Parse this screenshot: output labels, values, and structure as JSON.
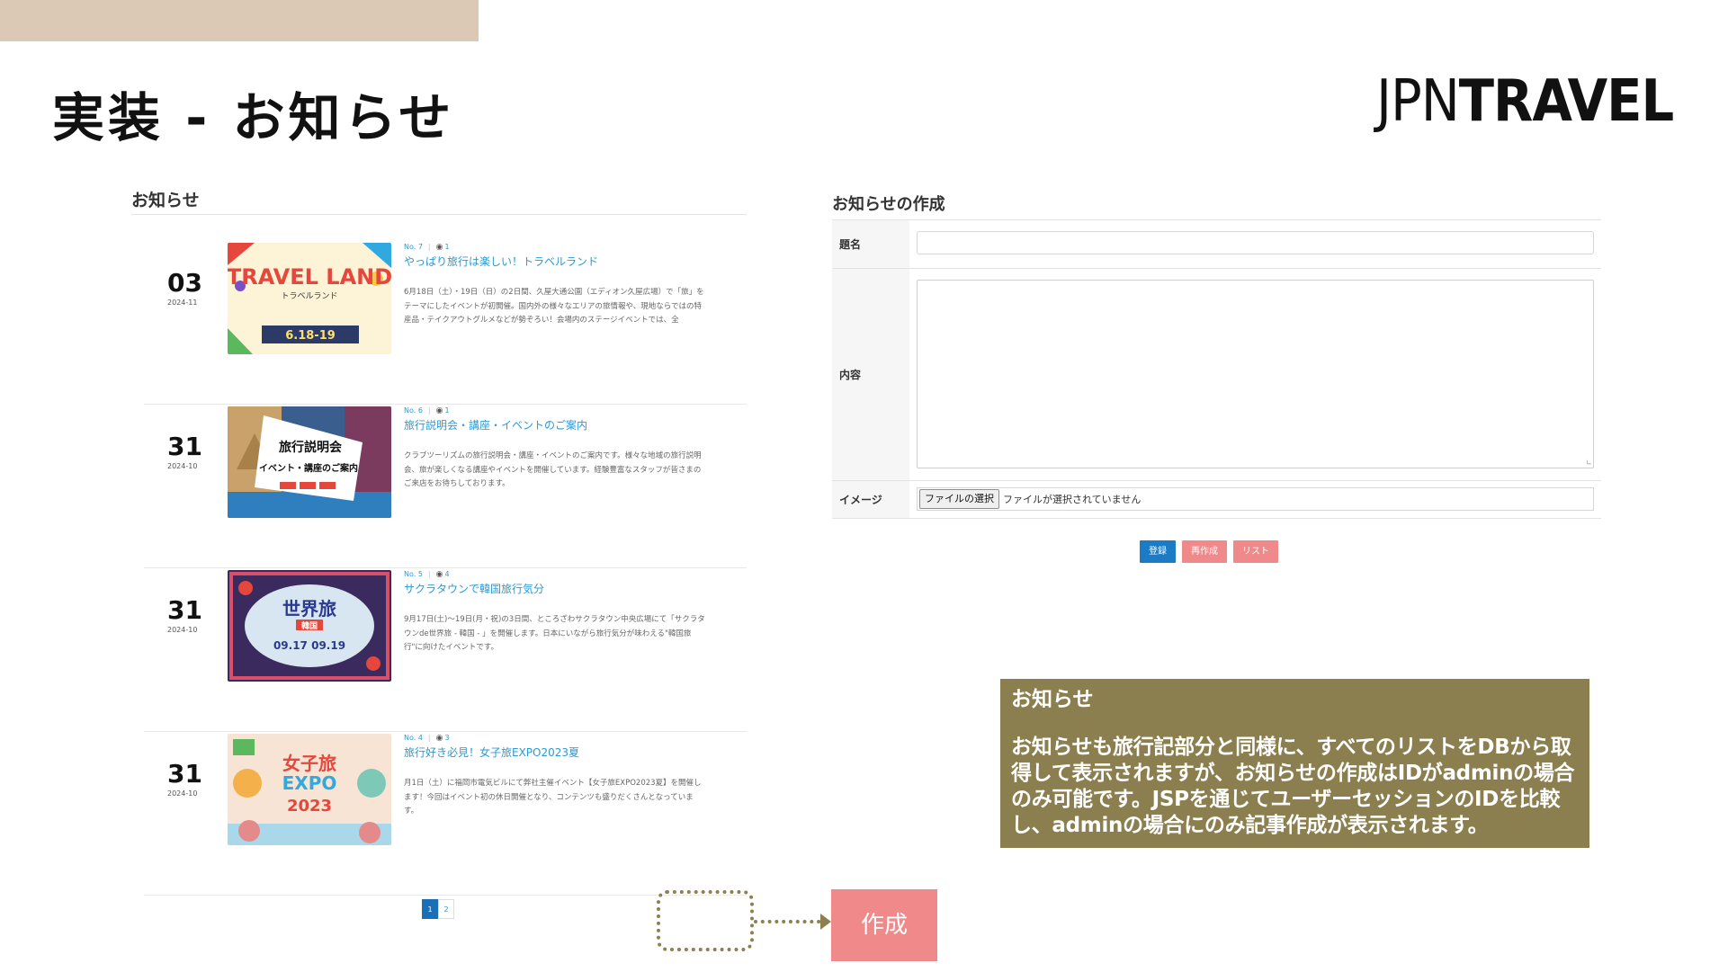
{
  "slide": {
    "title": "実装 - お知らせ",
    "logo_thin": "JPN",
    "logo_bold": "TRAVEL"
  },
  "list": {
    "heading": "お知らせ",
    "items": [
      {
        "day": "03",
        "ym": "2024-11",
        "no": "No. 7",
        "views": "1",
        "title": "やっぱり旅行は楽しい！トラベルランド",
        "desc": "6月18日（土）・19日（日）の2日間、久屋大通公園（エディオン久屋広場）で「旅」をテーマにしたイベントが初開催。国内外の様々なエリアの旅情報や、現地ならではの特産品・テイクアウトグルメなどが勢ぞろい！会場内のステージイベントでは、全",
        "thumb_text": "TRAVEL LAND",
        "thumb_sub": "トラベルランド",
        "thumb_date": "6.18-19"
      },
      {
        "day": "31",
        "ym": "2024-10",
        "no": "No. 6",
        "views": "1",
        "title": "旅行説明会・講座・イベントのご案内",
        "desc": "クラブツーリズムの旅行説明会・講座・イベントのご案内です。様々な地域の旅行説明会、旅が楽しくなる講座やイベントを開催しています。経験豊富なスタッフが皆さまのご来店をお待ちしております。",
        "thumb_text": "旅行説明会",
        "thumb_sub": "イベント・講座のご案内"
      },
      {
        "day": "31",
        "ym": "2024-10",
        "no": "No. 5",
        "views": "4",
        "title": "サクラタウンで韓国旅行気分",
        "desc": "9月17日(土)〜19日(月・祝)の3日間、ところざわサクラタウン中央広場にて「サクラタウンde世界旅 - 韓国 - 」を開催します。日本にいながら旅行気分が味わえる\"韓国旅行\"に向けたイベントです。",
        "thumb_text": "世界旅",
        "thumb_sub": "韓国",
        "thumb_date": "09.17 09.19"
      },
      {
        "day": "31",
        "ym": "2024-10",
        "no": "No. 4",
        "views": "3",
        "title": "旅行好き必見！女子旅EXPO2023夏",
        "desc": "月1日（土）に福岡市電気ビルにて弊社主催イベント【女子旅EXPO2023夏】を開催します！今回はイベント初の休日開催となり、コンテンツも盛りだくさんとなっています。",
        "thumb_text": "女子旅",
        "thumb_sub": "EXPO",
        "thumb_date": "2023"
      }
    ],
    "pages": [
      "1",
      "2"
    ],
    "active_page": "1"
  },
  "form": {
    "heading": "お知らせの作成",
    "title_label": "題名",
    "content_label": "内容",
    "image_label": "イメージ",
    "file_button": "ファイルの選択",
    "file_status": "ファイルが選択されていません",
    "submit_button": "登録",
    "reset_button": "再作成",
    "list_button": "リスト"
  },
  "create_button": "作成",
  "note": {
    "title": "お知らせ",
    "body": "お知らせも旅行記部分と同様に、すべてのリストをDBから取得して表示されますが、お知らせの作成はIDがadminの場合のみ可能です。JSPを通じてユーザーセッションのIDを比較し、adminの場合にのみ記事作成が表示されます。"
  },
  "colors": {
    "accent_bar": "#dcc9b5",
    "link_blue": "#2a9ad3",
    "primary_button": "#1b7bc4",
    "pink_button": "#f08a8a",
    "note_bg": "#8c7f4f"
  }
}
